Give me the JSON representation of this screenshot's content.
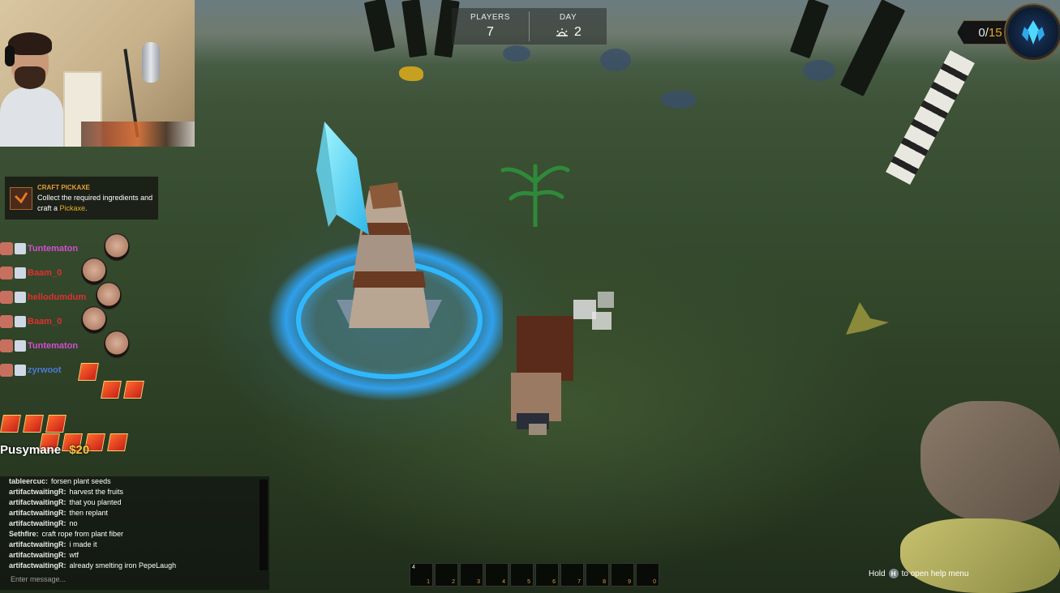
{
  "hud": {
    "players_label": "PLAYERS",
    "players_value": "7",
    "day_label": "DAY",
    "day_value": "2",
    "crystal_count": "0",
    "crystal_max": "15"
  },
  "quest": {
    "title": "Craft Pickaxe",
    "text_prefix": "Collect the required ingredients and craft a ",
    "highlight": "Pickaxe",
    "text_suffix": "."
  },
  "alerts": [
    {
      "name": "Tuntematon",
      "color": "#d04fd0"
    },
    {
      "name": "Baam_0",
      "color": "#e03030"
    },
    {
      "name": "hellodumdum",
      "color": "#e03030"
    },
    {
      "name": "Baam_0",
      "color": "#e03030"
    },
    {
      "name": "Tuntematon",
      "color": "#d04fd0"
    },
    {
      "name": "zyrwoot",
      "color": "#4a7ad8"
    }
  ],
  "tip": {
    "name": "Pusymane",
    "amount": "$20"
  },
  "chat": {
    "messages": [
      {
        "user": "tableercuc:",
        "text": "forsen plant seeds"
      },
      {
        "user": "artifactwaitingR:",
        "text": "harvest the fruits"
      },
      {
        "user": "artifactwaitingR:",
        "text": "that you planted"
      },
      {
        "user": "artifactwaitingR:",
        "text": "then replant"
      },
      {
        "user": "artifactwaitingR:",
        "text": "no"
      },
      {
        "user": "Sethfire:",
        "text": "craft rope from plant fiber"
      },
      {
        "user": "artifactwaitingR:",
        "text": "i made it"
      },
      {
        "user": "artifactwaitingR:",
        "text": "wtf"
      },
      {
        "user": "artifactwaitingR:",
        "text": "already smelting iron PepeLaugh"
      }
    ],
    "placeholder": "Enter message..."
  },
  "hotbar": {
    "slots": [
      "1",
      "2",
      "3",
      "4",
      "5",
      "6",
      "7",
      "8",
      "9",
      "0"
    ],
    "first_count": "4"
  },
  "help": {
    "prefix": "Hold",
    "key": "H",
    "suffix": "to open help menu"
  },
  "colors": {
    "crystal": "#4fd8ff",
    "ring": "#2fa8ff",
    "accent": "#e3a928"
  }
}
